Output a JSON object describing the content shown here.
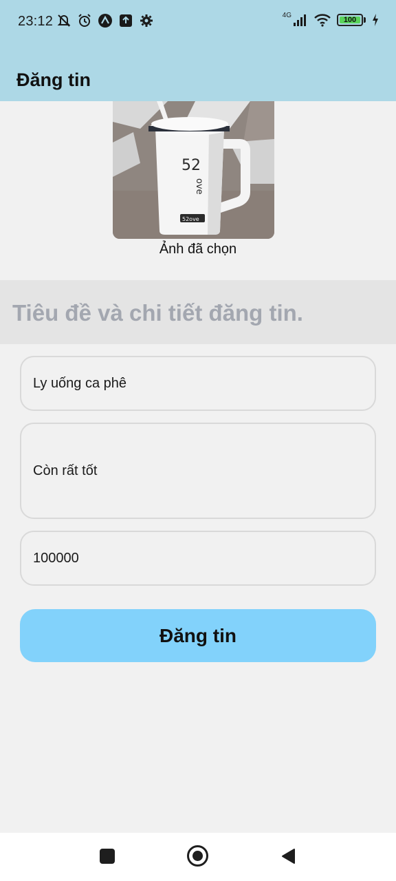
{
  "status_bar": {
    "time": "23:12",
    "network_label": "4G",
    "battery_level": "100",
    "icons_left": [
      "mute-icon",
      "alarm-icon",
      "app-a-icon",
      "upload-icon",
      "settings-icon"
    ],
    "icons_right": [
      "signal-icon",
      "wifi-icon",
      "battery-icon",
      "charging-icon"
    ]
  },
  "app_bar": {
    "title": "Đăng tin"
  },
  "image": {
    "caption": "Ảnh đã chọn"
  },
  "section": {
    "title": "Tiêu đề và chi tiết đăng tin."
  },
  "form": {
    "title_value": "Ly uống ca phê",
    "description_value": "Còn rất tốt",
    "price_value": "100000",
    "submit_label": "Đăng tin"
  },
  "nav_bar": {
    "buttons": [
      "recents-icon",
      "home-icon",
      "back-icon"
    ]
  },
  "colors": {
    "app_bar_bg": "#add8e6",
    "page_bg": "#f1f1f1",
    "section_band_bg": "#e4e4e4",
    "section_title": "#a3a7b0",
    "submit_bg": "#82d2fb"
  }
}
